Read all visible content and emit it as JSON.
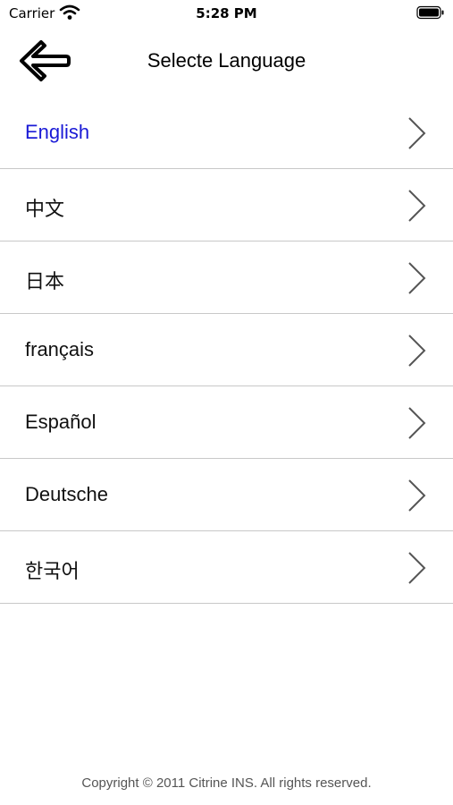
{
  "status_bar": {
    "carrier": "Carrier",
    "time": "5:28 PM",
    "wifi_icon": "wifi-icon",
    "battery_icon": "battery-icon"
  },
  "nav": {
    "title": "Selecte Language",
    "back_icon": "back-arrow-icon"
  },
  "languages": [
    {
      "label": "English",
      "selected": true
    },
    {
      "label": "中文",
      "selected": false
    },
    {
      "label": "日本",
      "selected": false
    },
    {
      "label": "français",
      "selected": false
    },
    {
      "label": "Español",
      "selected": false
    },
    {
      "label": "Deutsche",
      "selected": false
    },
    {
      "label": "한국어",
      "selected": false
    }
  ],
  "footer": {
    "copyright": "Copyright © 2011 Citrine INS. All rights reserved."
  },
  "colors": {
    "selected_text": "#1a1ad6",
    "separator": "#c8c8c8",
    "chevron": "#555555"
  }
}
